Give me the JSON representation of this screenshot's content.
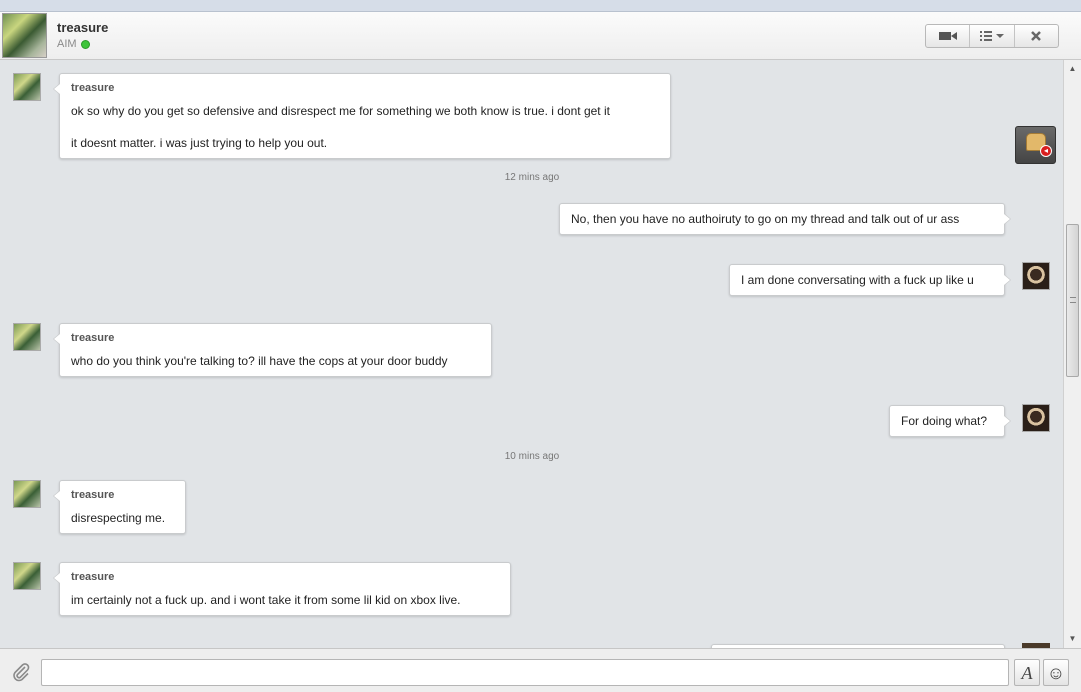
{
  "header": {
    "contact_name": "treasure",
    "service": "AIM",
    "status_color": "#3ec43a",
    "buttons": [
      {
        "icon": "video-camera-icon"
      },
      {
        "icon": "list-menu-icon"
      },
      {
        "icon": "close-icon"
      }
    ]
  },
  "messages": [
    {
      "sender": "treasure",
      "lines": [
        "ok so why do you get so defensive and disrespect me for something we both know is true. i dont get it",
        "it doesnt matter. i was just trying to help you out."
      ]
    },
    {
      "time": "12 mins ago"
    },
    {
      "sender": "me",
      "text": "No, then you have no authoiruty to go on my thread and talk out of ur ass"
    },
    {
      "sender": "me",
      "text": "I am done conversating with a fuck up like u"
    },
    {
      "sender": "treasure",
      "text": "who do you think you're talking to? ill have the cops at your door buddy"
    },
    {
      "sender": "me",
      "text": "For doing what?"
    },
    {
      "time": "10 mins ago"
    },
    {
      "sender": "treasure",
      "text": "disrespecting me."
    },
    {
      "sender": "treasure",
      "text": "im certainly not a fuck up. and i wont take it from some lil kid on xbox live."
    }
  ],
  "composer": {
    "placeholder": "",
    "value": "",
    "font_button_label": "A",
    "emoji_icon": "smiley-icon",
    "attach_icon": "paperclip-icon"
  }
}
